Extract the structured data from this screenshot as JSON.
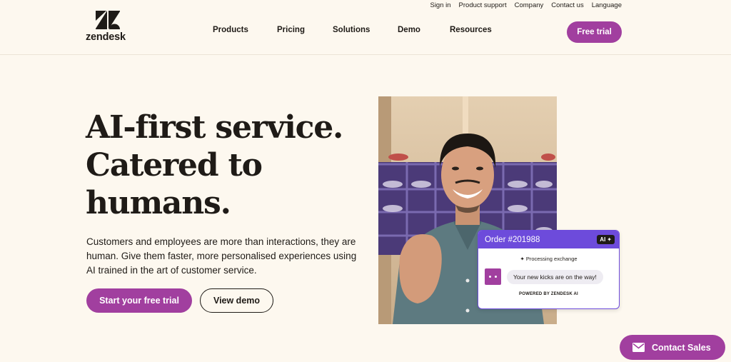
{
  "utility_nav": [
    "Sign in",
    "Product support",
    "Company",
    "Contact us",
    "Language"
  ],
  "brand": {
    "name": "zendesk"
  },
  "nav": {
    "items": [
      "Products",
      "Pricing",
      "Solutions",
      "Demo",
      "Resources"
    ]
  },
  "header": {
    "cta": "Free trial"
  },
  "hero": {
    "title_lines": [
      "AI-first service.",
      "Catered to",
      "humans."
    ],
    "subtitle": "Customers and employees are more than interactions, they are human. Give them faster, more personalised experiences using AI trained in the art of customer service.",
    "primary_cta": "Start your free trial",
    "secondary_cta": "View demo"
  },
  "chat_card": {
    "order_label": "Order #201988",
    "badge": "AI",
    "status": "Processing exchange",
    "message": "Your new kicks are on the way!",
    "footer": "POWERED BY ZENDESK AI"
  },
  "contact": {
    "label": "Contact Sales"
  },
  "colors": {
    "background": "#fdf8ef",
    "brand_purple": "#a13f9f",
    "chat_purple": "#6d4bdb",
    "text": "#1f1b17"
  }
}
